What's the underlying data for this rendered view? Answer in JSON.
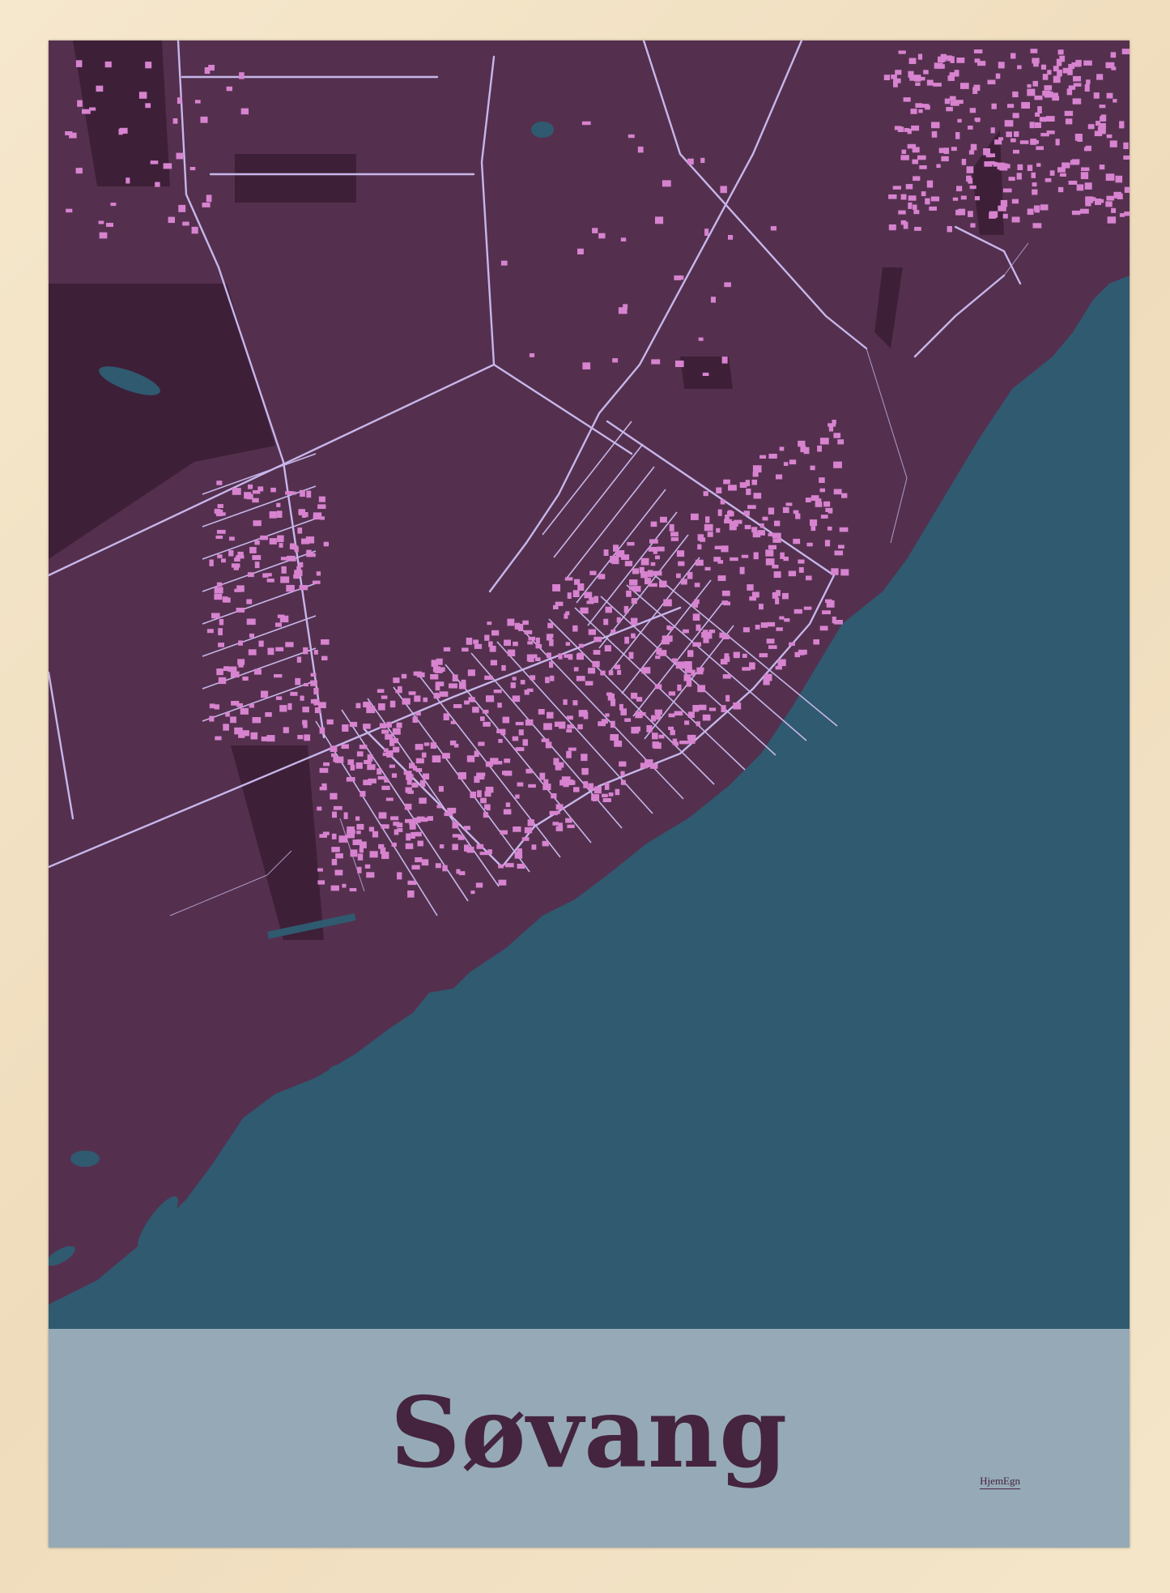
{
  "poster": {
    "title": "Søvang",
    "brand": "HjemEgn"
  },
  "colors": {
    "frame": "#f1e2c6",
    "land": "#54304e",
    "land_dark": "#3d2038",
    "water": "#2f5a70",
    "roads": "#c7b6ea",
    "buildings": "#d783cf",
    "label_band": "#95aab6",
    "title_text": "#45243f"
  },
  "icons": [
    "frame-border",
    "map-poster",
    "brand-logo"
  ]
}
